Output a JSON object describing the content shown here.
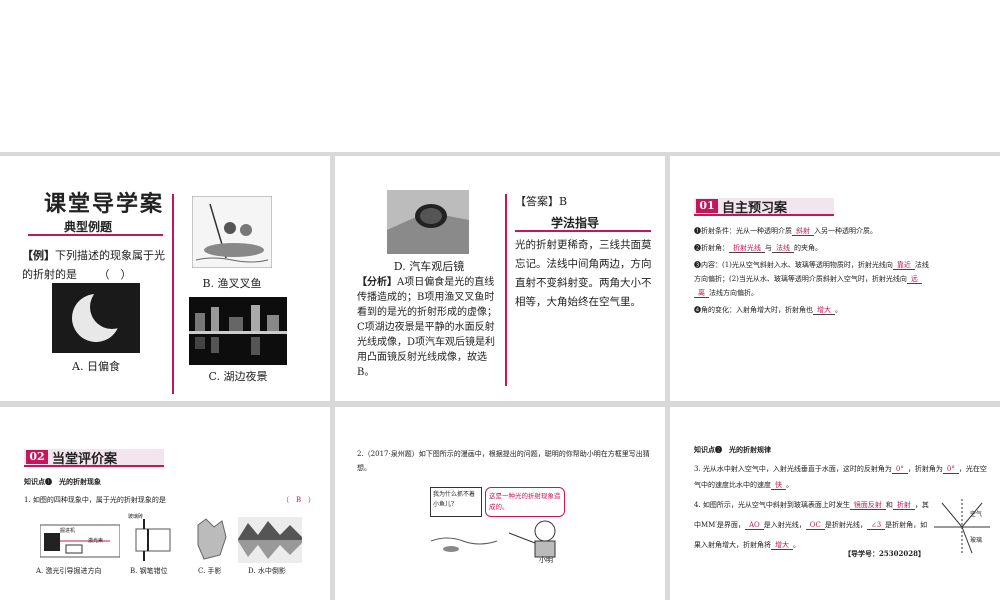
{
  "slide1": {
    "title": "课堂导学案",
    "section": "典型例题",
    "question_tag": "【例】",
    "question": "下列描述的现象属于光的折射的是",
    "blank": "（　）",
    "captions": [
      "A. 日偏食",
      "B. 渔叉叉鱼",
      "C. 湖边夜景"
    ]
  },
  "slide2": {
    "caption_d": "D. 汽车观后镜",
    "analysis_tag": "【分析】",
    "analysis": "A项日偏食是光的直线传播造成的；B项用渔叉叉鱼时看到的是光的折射形成的虚像；C项湖边夜景是平静的水面反射光线成像，D项汽车观后镜是利用凸面镜反射光线成像，故选B。",
    "answer": "【答案】B",
    "method_title": "学法指导",
    "method": "光的折射更稀奇，三线共面莫忘记。法线中间角两边，方向直射不变斜射变。两角大小不相等，大角始终在空气里。"
  },
  "slide3": {
    "badge": "01",
    "title": "自主预习案",
    "items": [
      {
        "pre": "❶折射条件：光从一种透明介质",
        "ans": "斜射",
        "post": "入另一种透明介质。"
      },
      {
        "pre": "❷折射角：",
        "ans": "折射光线",
        "mid": "与",
        "ans2": "法线",
        "post": "的夹角。"
      },
      {
        "pre": "❸内容：(1)光从空气斜射入水、玻璃等透明物质时，折射光线向",
        "ans": "靠近",
        "post": "法线"
      },
      {
        "pre": "方向偏折；(2)当光从水、玻璃等透明介质斜射入空气时，折射光线向",
        "ans": "远",
        "post": ""
      },
      {
        "pre": "",
        "ans": "离",
        "post": "法线方向偏折。"
      },
      {
        "pre": "❹角的变化：入射角增大时，折射角也",
        "ans": "增大",
        "post": "。"
      }
    ]
  },
  "slide4": {
    "badge": "02",
    "title": "当堂评价案",
    "knowledge": "知识点❶　光的折射现象",
    "question": "1. 如图的四种现象中，属于光的折射现象的是",
    "answer": "（　B　）",
    "captions": [
      "A. 激光引导掘进方向",
      "B. 钢笔错位",
      "C. 手影",
      "D. 水中倒影"
    ],
    "fig_labels": [
      "玻璃砖",
      "激光束",
      "掘进机"
    ]
  },
  "slide5": {
    "question": "2.（2017·泉州题）如下图所示的漫画中，根据提出的问题，聪明的你帮助小明在方框里写出猜想。",
    "bubble_q": "我为什么抓不着小鱼儿？",
    "bubble_a": "这是一种光的折射现象造成的。",
    "name": "小明"
  },
  "slide6": {
    "knowledge": "知识点❷　光的折射规律",
    "q3_pre": "3. 光从水中射入空气中，入射光线垂直于水面，这时的反射角为",
    "q3_a1": "0°",
    "q3_mid1": "，折射角为",
    "q3_a2": "0°",
    "q3_mid2": "，光在空气中的速度比水中的速度",
    "q3_a3": "快",
    "q4_pre": "4. 如图所示，光从空气中斜射到玻璃表面上时发生",
    "q4_a1": "镜面反射",
    "q4_mid1": "和",
    "q4_a2": "折射",
    "q4_mid2": "，其中MM′是界面，",
    "q4_a3": "AO",
    "q4_mid3": "是入射光线，",
    "q4_a4": "OC",
    "q4_mid4": "是折射光线，",
    "q4_a5": "∠3",
    "q4_mid5": "是折射角，如果入射角增大，折射角将",
    "q4_a6": "增大",
    "guide": "【导学号：25302028】",
    "fig_air": "空气",
    "fig_glass": "玻璃"
  }
}
